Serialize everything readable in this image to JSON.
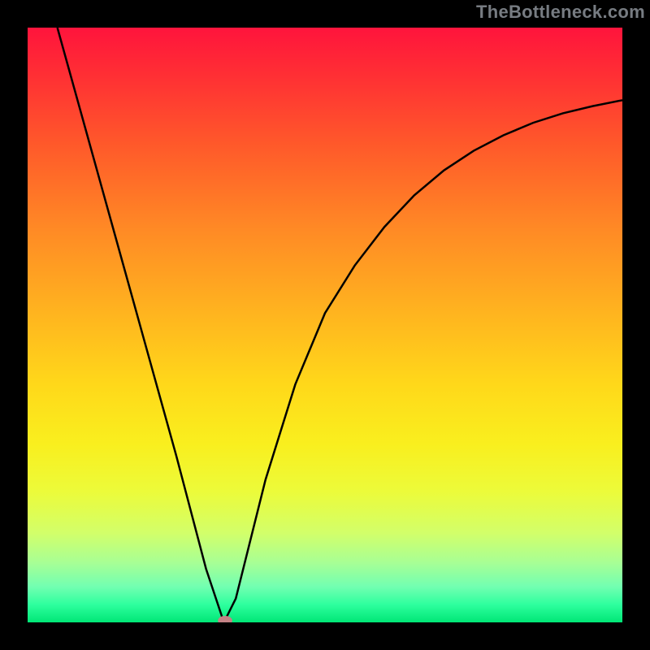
{
  "watermark": "TheBottleneck.com",
  "chart_data": {
    "type": "line",
    "title": "",
    "xlabel": "",
    "ylabel": "",
    "xlim": [
      0,
      1
    ],
    "ylim": [
      0,
      1
    ],
    "grid": false,
    "legend": false,
    "series": [
      {
        "name": "curve",
        "x": [
          0.05,
          0.1,
          0.15,
          0.2,
          0.25,
          0.3,
          0.33,
          0.35,
          0.37,
          0.4,
          0.45,
          0.5,
          0.55,
          0.6,
          0.65,
          0.7,
          0.75,
          0.8,
          0.85,
          0.9,
          0.95,
          1.0
        ],
        "y": [
          1.0,
          0.82,
          0.64,
          0.46,
          0.28,
          0.09,
          0.0,
          0.04,
          0.12,
          0.24,
          0.4,
          0.52,
          0.6,
          0.665,
          0.718,
          0.76,
          0.793,
          0.819,
          0.84,
          0.856,
          0.868,
          0.878
        ]
      }
    ],
    "marker": {
      "x": 0.332,
      "y": 0.003,
      "rx": 0.012,
      "ry": 0.008,
      "color": "#c48285"
    },
    "background_gradient": {
      "top": "#ff143c",
      "bottom": "#00e676"
    }
  }
}
